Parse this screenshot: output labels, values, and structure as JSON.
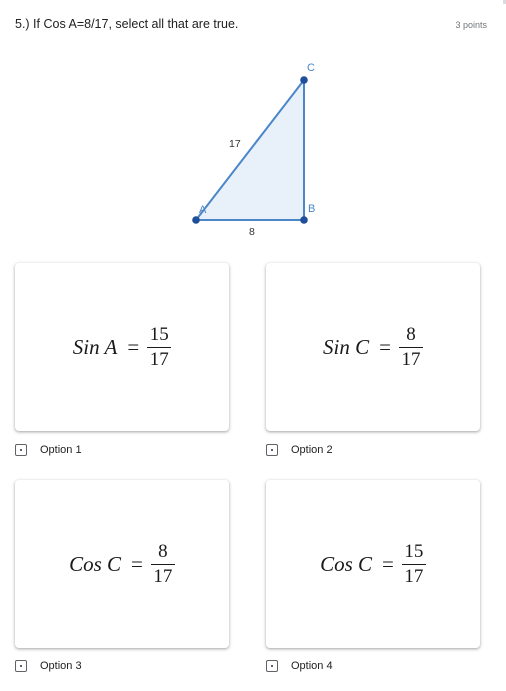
{
  "question": {
    "title": "5.) If Cos A=8/17, select all that are true.",
    "points": "3 points"
  },
  "figure": {
    "vertices": {
      "A": "A",
      "B": "B",
      "C": "C"
    },
    "hypotenuse_label": "17",
    "base_label": "8",
    "line_color": "#4a86c8",
    "fill_color": "#e8f0fa",
    "point_color": "#1f4f9a"
  },
  "options": [
    {
      "label": "Option 1",
      "checked": false,
      "equation": {
        "lhs_func": "Sin",
        "lhs_angle": "A",
        "sign": "=",
        "numerator": "15",
        "denominator": "17"
      }
    },
    {
      "label": "Option 2",
      "checked": false,
      "equation": {
        "lhs_func": "Sin",
        "lhs_angle": "C",
        "sign": "=",
        "numerator": "8",
        "denominator": "17"
      }
    },
    {
      "label": "Option 3",
      "checked": false,
      "equation": {
        "lhs_func": "Cos",
        "lhs_angle": "C",
        "sign": "=",
        "numerator": "8",
        "denominator": "17"
      }
    },
    {
      "label": "Option 4",
      "checked": false,
      "equation": {
        "lhs_func": "Cos",
        "lhs_angle": "C",
        "sign": "=",
        "numerator": "15",
        "denominator": "17"
      }
    }
  ]
}
